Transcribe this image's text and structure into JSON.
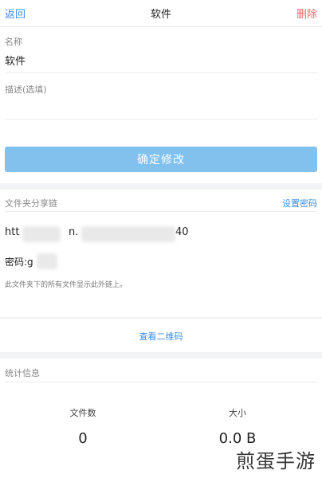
{
  "header": {
    "back_label": "返回",
    "title": "软件",
    "delete_label": "删除"
  },
  "form": {
    "name_label": "名称",
    "name_value": "软件",
    "desc_label": "描述(选填)",
    "confirm_label": "确定修改"
  },
  "share": {
    "section_label": "文件夹分享链",
    "set_password_label": "设置密码",
    "link_start": "htt",
    "link_mid": "n.",
    "link_end": "40",
    "password_label": "密码:g",
    "note": "此文件夹下的所有文件显示此外链上。"
  },
  "qrcode_label": "查看二维码",
  "stats": {
    "section_label": "统计信息",
    "files_label": "文件数",
    "files_value": "0",
    "size_label": "大小",
    "size_value": "0.0 B"
  },
  "watermark": "煎蛋手游",
  "colors": {
    "accent": "#3a8ee6",
    "danger": "#e46a6a",
    "button": "#82c0ee"
  }
}
